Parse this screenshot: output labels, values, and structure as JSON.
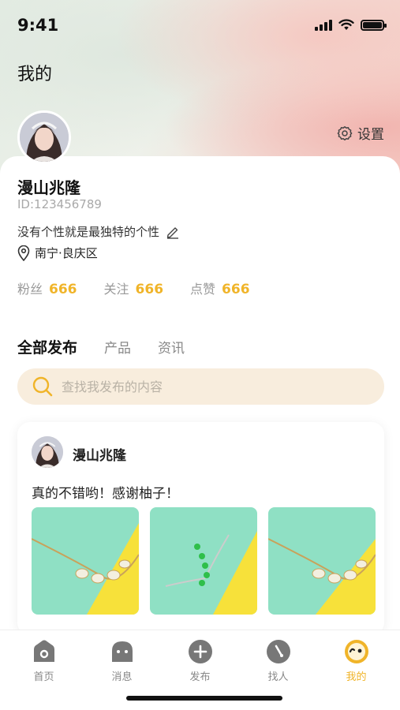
{
  "status_bar": {
    "time": "9:41"
  },
  "header": {
    "title": "我的",
    "settings_label": "设置"
  },
  "profile": {
    "name": "漫山兆隆",
    "id_text": "ID:123456789",
    "bio": "没有个性就是最独特的个性",
    "location": "南宁·良庆区",
    "stats": [
      {
        "label": "粉丝",
        "value": "666"
      },
      {
        "label": "关注",
        "value": "666"
      },
      {
        "label": "点赞",
        "value": "666"
      }
    ]
  },
  "content_tabs": [
    {
      "label": "全部发布",
      "active": true
    },
    {
      "label": "产品",
      "active": false
    },
    {
      "label": "资讯",
      "active": false
    }
  ],
  "search": {
    "placeholder": "查找我发布的内容",
    "value": ""
  },
  "post": {
    "author": "漫山兆隆",
    "text": "真的不错哟！感谢柚子！",
    "images": [
      "necklace-image",
      "bracelet-image",
      "necklace-image"
    ]
  },
  "tabbar": [
    {
      "label": "首页",
      "icon": "home-icon",
      "active": false
    },
    {
      "label": "消息",
      "icon": "message-icon",
      "active": false
    },
    {
      "label": "发布",
      "icon": "publish-icon",
      "active": false
    },
    {
      "label": "找人",
      "icon": "find-people-icon",
      "active": false
    },
    {
      "label": "我的",
      "icon": "me-icon",
      "active": true
    }
  ],
  "colors": {
    "accent": "#f0b429",
    "search_bg": "#f8eddd",
    "muted": "#999999"
  }
}
